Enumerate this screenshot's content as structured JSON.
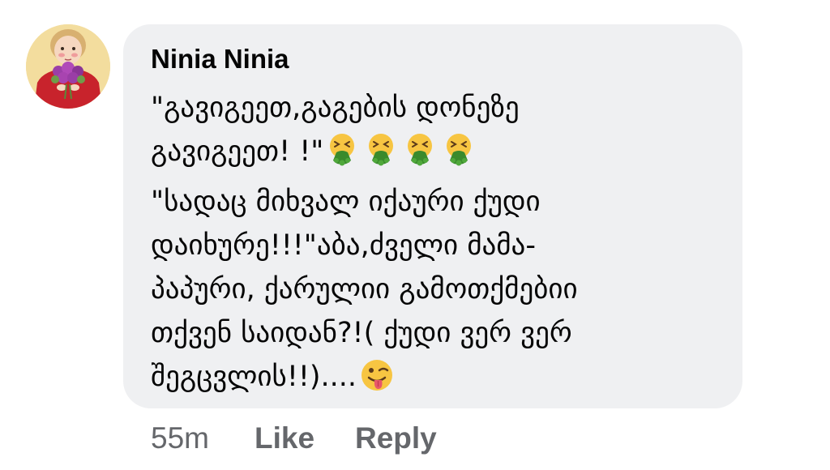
{
  "comment": {
    "author": "Ninia Ninia",
    "lines": [
      "\"გავიგეეთ,გაგების დონეზე",
      "გავიგეეთ! !\"",
      "\"სადაც მიხვალ იქაური ქუდი",
      "დაიხურე!!!\"აბა,ძველი მამა-",
      "პაპური, ქარულიი გამოთქმებიი",
      "თქვენ საიდან?!( ქუდი ვერ ვერ",
      "შეგცვლის!!)...."
    ],
    "icons": [
      "nauseated-vomiting-face-icon",
      "winking-face-with-tongue-icon"
    ]
  },
  "actions": {
    "time": "55m",
    "like": "Like",
    "reply": "Reply"
  },
  "colors": {
    "bubble": "#eff0f2",
    "text": "#050505",
    "muted": "#65676b"
  }
}
